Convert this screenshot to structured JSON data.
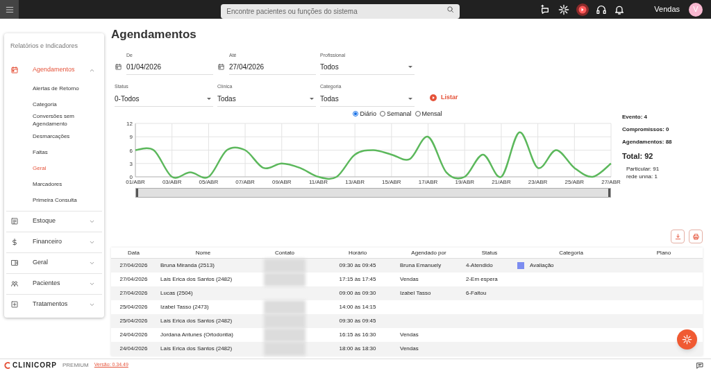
{
  "topbar": {
    "search_placeholder": "Encontre pacientes ou funções do sistema",
    "user": "Vendas",
    "avatar": "V"
  },
  "sidebar": {
    "title": "Relatórios e Indicadores",
    "items": [
      {
        "label": "Agendamentos",
        "expanded": true,
        "selected": true,
        "children": [
          {
            "label": "Alertas de Retorno",
            "selected": false
          },
          {
            "label": "Categoria",
            "selected": false
          },
          {
            "label": "Conversões sem Agendamento",
            "selected": false
          },
          {
            "label": "Desmarcações",
            "selected": false
          },
          {
            "label": "Faltas",
            "selected": false
          },
          {
            "label": "Geral",
            "selected": true
          },
          {
            "label": "Marcadores",
            "selected": false
          },
          {
            "label": "Primeira Consulta",
            "selected": false
          }
        ]
      },
      {
        "label": "Estoque",
        "expanded": false,
        "selected": false
      },
      {
        "label": "Financeiro",
        "expanded": false,
        "selected": false
      },
      {
        "label": "Geral",
        "expanded": false,
        "selected": false
      },
      {
        "label": "Pacientes",
        "expanded": false,
        "selected": false
      },
      {
        "label": "Tratamentos",
        "expanded": false,
        "selected": false
      }
    ]
  },
  "page_title": "Agendamentos",
  "filters": [
    {
      "kind": "date",
      "label": "De",
      "value": "01/04/2026"
    },
    {
      "kind": "date",
      "label": "Até",
      "value": "27/04/2026"
    },
    {
      "kind": "select",
      "label": "Profissional",
      "value": "Todos"
    },
    {
      "kind": "select",
      "label": "Status",
      "value": "0-Todos"
    },
    {
      "kind": "select",
      "label": "Clínica",
      "value": "Todas"
    },
    {
      "kind": "select",
      "label": "Categoria",
      "value": "Todas"
    }
  ],
  "list_button": "Listar",
  "period_options": [
    {
      "label": "Diário",
      "selected": true
    },
    {
      "label": "Semanal",
      "selected": false
    },
    {
      "label": "Mensal",
      "selected": false
    }
  ],
  "chart_data": {
    "type": "line",
    "x": [
      1,
      2,
      3,
      4,
      5,
      6,
      7,
      8,
      9,
      10,
      11,
      12,
      13,
      14,
      15,
      16,
      17,
      18,
      19,
      20,
      21,
      22,
      23,
      24,
      25,
      26,
      27
    ],
    "grid": true,
    "series": [
      {
        "color": "#5cb85c",
        "values": [
          6,
          6,
          0,
          1,
          0,
          6,
          6,
          2,
          3,
          2,
          0,
          0,
          5,
          6,
          5,
          4,
          9,
          1,
          0,
          5,
          0,
          10,
          2,
          6,
          2,
          0,
          3
        ]
      }
    ],
    "ylim": [
      0,
      12
    ],
    "yticks": [
      0,
      3,
      6,
      9,
      12
    ],
    "xlim": [
      1,
      27
    ],
    "xticks": [
      {
        "value": 1,
        "label": "01/ABR"
      },
      {
        "value": 3,
        "label": "03/ABR"
      },
      {
        "value": 5,
        "label": "05/ABR"
      },
      {
        "value": 7,
        "label": "07/ABR"
      },
      {
        "value": 9,
        "label": "09/ABR"
      },
      {
        "value": 11,
        "label": "11/ABR"
      },
      {
        "value": 13,
        "label": "13/ABR"
      },
      {
        "value": 15,
        "label": "15/ABR"
      },
      {
        "value": 17,
        "label": "17/ABR"
      },
      {
        "value": 19,
        "label": "19/ABR"
      },
      {
        "value": 21,
        "label": "21/ABR"
      },
      {
        "value": 23,
        "label": "23/ABR"
      },
      {
        "value": 25,
        "label": "25/ABR"
      },
      {
        "value": 27,
        "label": "27/ABR"
      }
    ]
  },
  "zoom_slider": {
    "level": 1
  },
  "summary": {
    "lines": [
      "Evento: 4",
      "Compromissos: 0",
      "Agendamentos: 88"
    ],
    "total": "Total: 92",
    "breakdown": [
      "Particular: 91",
      "rede unna: 1"
    ]
  },
  "table": {
    "columns": [
      "Data",
      "Nome",
      "Contato",
      "Horário",
      "Agendado por",
      "Status",
      "Categoria",
      "Plano"
    ],
    "rows": [
      {
        "date": "27/04/2026",
        "name": "Bruna Miranda (2513)",
        "contact_blurred": true,
        "time": "09:30 às 09:45",
        "by": "Bruna Emanuely",
        "status": "4-Atendido",
        "category": "Avaliação",
        "color": "#7b8cf0"
      },
      {
        "date": "27/04/2026",
        "name": "Laís Erica dos Santos (2482)",
        "contact_blurred": true,
        "time": "17:15 às 17:45",
        "by": "Vendas",
        "status": "2-Em espera"
      },
      {
        "date": "27/04/2026",
        "name": "Lucas (2504)",
        "contact_blurred": false,
        "time": "09:00 às 09:30",
        "by": "Izabel Tasso",
        "status": "6-Faltou"
      },
      {
        "date": "25/04/2026",
        "name": "Izabel Tasso (2473)",
        "contact_blurred": true,
        "time": "14:00 às 14:15"
      },
      {
        "date": "25/04/2026",
        "name": "Laís Erica dos Santos (2482)",
        "contact_blurred": true,
        "time": "09:30 às 09:45"
      },
      {
        "date": "24/04/2026",
        "name": "Jordana Antunes (Ortodontia)",
        "contact_blurred": true,
        "time": "16:15 às 16:30",
        "by": "Vendas"
      },
      {
        "date": "24/04/2026",
        "name": "Laís Erica dos Santos (2482)",
        "contact_blurred": true,
        "time": "18:00 às 18:30",
        "by": "Vendas"
      }
    ]
  },
  "footer": {
    "brand": "CLINICORP",
    "plan": "PREMIUM",
    "version": "Versão: 0.34.49"
  }
}
